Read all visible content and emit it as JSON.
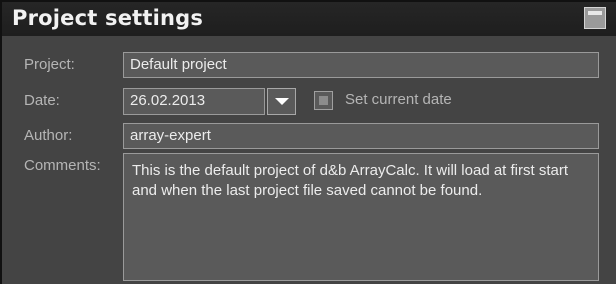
{
  "panel": {
    "title": "Project settings",
    "minimize_icon": "minimize-icon"
  },
  "fields": {
    "project": {
      "label": "Project:",
      "value": "Default project"
    },
    "date": {
      "label": "Date:",
      "value": "26.02.2013",
      "dropdown_icon": "chevron-down-icon"
    },
    "set_current_date": {
      "label": "Set current date",
      "checked": false
    },
    "author": {
      "label": "Author:",
      "value": "array-expert"
    },
    "comments": {
      "label": "Comments:",
      "value": "This is the default project of d&b ArrayCalc. It will load at first start and when the last project file saved cannot be found."
    }
  },
  "colors": {
    "panel_bg": "#444444",
    "titlebar_bg": "#222222",
    "field_bg": "#5a5a5a",
    "label_text": "#b5b5b5",
    "field_text": "#ececec"
  }
}
